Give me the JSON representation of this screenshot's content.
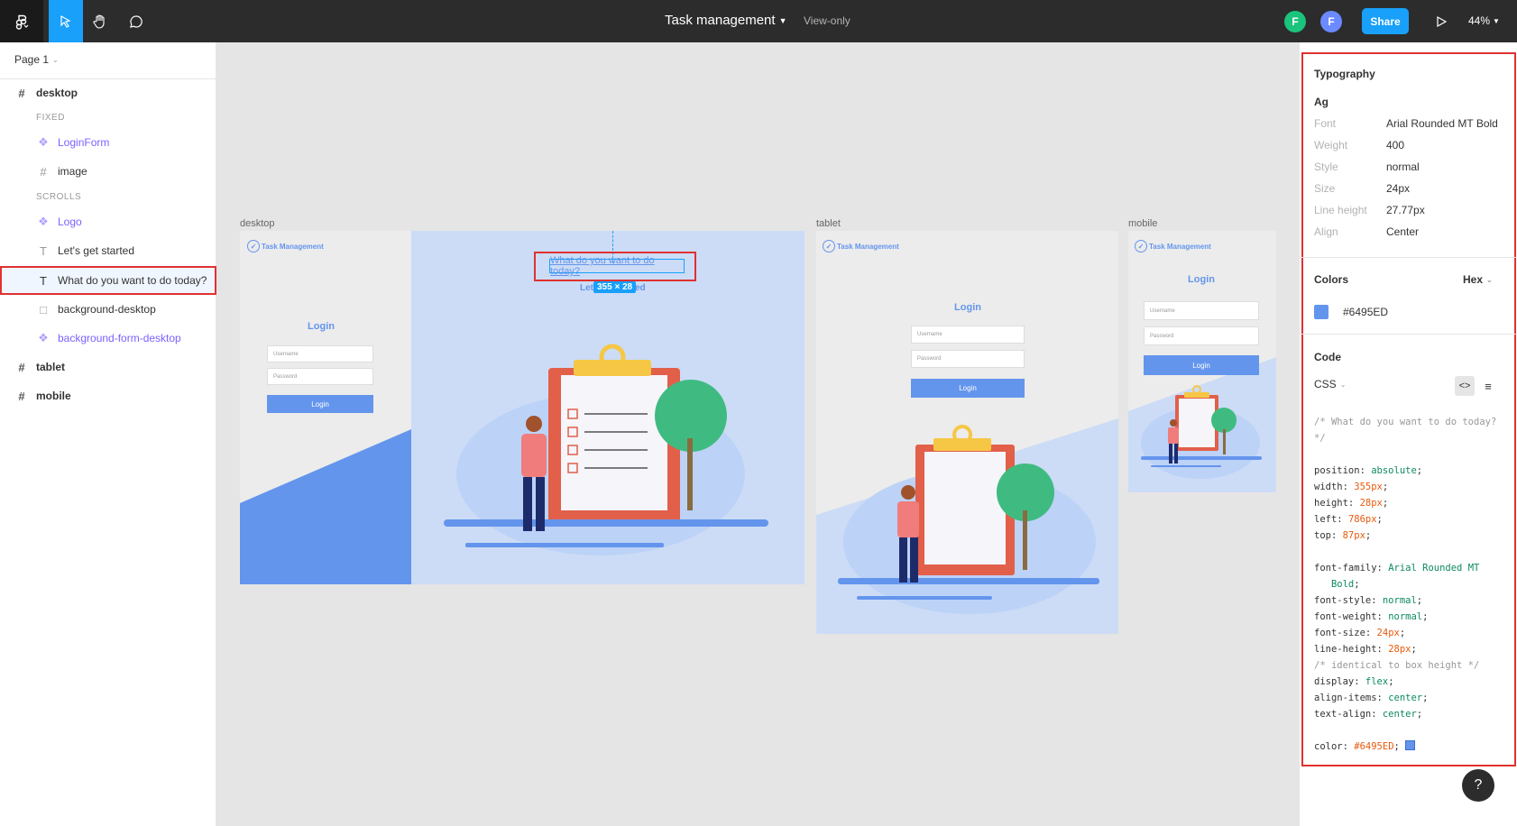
{
  "toolbar": {
    "title": "Task management",
    "view_only": "View-only",
    "avatar1": "F",
    "avatar2": "F",
    "share_label": "Share",
    "zoom": "44%"
  },
  "layers": {
    "page_name": "Page 1",
    "desktop": "desktop",
    "fixed_label": "FIXED",
    "login_form": "LoginForm",
    "image": "image",
    "scrolls_label": "SCROLLS",
    "logo": "Logo",
    "lets_get_started": "Let's get started",
    "what_do_you_want": "What do you want to do today?",
    "background_desktop": "background-desktop",
    "background_form_desktop": "background-form-desktop",
    "tablet": "tablet",
    "mobile": "mobile"
  },
  "canvas": {
    "desktop_label": "desktop",
    "tablet_label": "tablet",
    "mobile_label": "mobile",
    "brand": "Task Management",
    "login": "Login",
    "username_placeholder": "Username",
    "password_placeholder": "Password",
    "login_button": "Login",
    "selected_text": "What do you want to do today?",
    "size_badge": "355 × 28",
    "subtext_left": "Let",
    "subtext_right": "ed"
  },
  "inspect": {
    "typography_title": "Typography",
    "ag": "Ag",
    "props": [
      {
        "label": "Font",
        "value": "Arial Rounded MT Bold"
      },
      {
        "label": "Weight",
        "value": "400"
      },
      {
        "label": "Style",
        "value": "normal"
      },
      {
        "label": "Size",
        "value": "24px"
      },
      {
        "label": "Line height",
        "value": "27.77px"
      },
      {
        "label": "Align",
        "value": "Center"
      }
    ],
    "colors_title": "Colors",
    "color_format": "Hex",
    "color_value": "#6495ED",
    "code_title": "Code",
    "code_lang": "CSS",
    "help": "?"
  },
  "colors": {
    "accent": "#18a0fb",
    "brand": "#6495ed",
    "highlight": "#e03131"
  }
}
